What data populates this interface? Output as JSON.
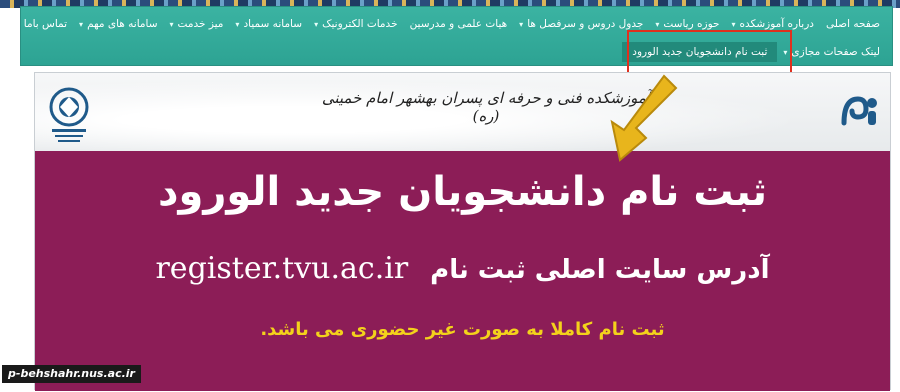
{
  "nav": {
    "row1": [
      {
        "label": "صفحه اصلی",
        "dropdown": false
      },
      {
        "label": "درباره آموزشکده",
        "dropdown": true
      },
      {
        "label": "حوزه ریاست",
        "dropdown": true
      },
      {
        "label": "جدول دروس و سرفصل ها",
        "dropdown": true
      },
      {
        "label": "هیات علمی و مدرسین",
        "dropdown": false
      },
      {
        "label": "خدمات الکترونیک",
        "dropdown": true
      },
      {
        "label": "سامانه سمیاد",
        "dropdown": true
      },
      {
        "label": "میز خدمت",
        "dropdown": true
      },
      {
        "label": "سامانه های مهم",
        "dropdown": true
      },
      {
        "label": "تماس باما",
        "dropdown": false
      }
    ],
    "row2": [
      {
        "label": "ثبت نام دانشجویان جدید الورود",
        "dropdown": false,
        "active": true
      },
      {
        "label": "لینک صفحات مجازی",
        "dropdown": true
      }
    ],
    "chevron": "▾"
  },
  "banner": {
    "school_title": "آموزشکده فنی و حرفه ای پسران بهشهر امام خمینی (ره)",
    "headline": "ثبت نام دانشجویان جدید الورود",
    "address_label": "آدرس سایت اصلی ثبت نام",
    "address_url": "register.tvu.ac.ir",
    "note": "ثبت نام کاملا به صورت غیر حضوری می باشد."
  },
  "watermark": "p-behshahr.nus.ac.ir",
  "colors": {
    "nav_teal": "#2da393",
    "panel_maroon": "#8c1d57",
    "note_yellow": "#f3d21b",
    "arrow_gold": "#e8b51c",
    "highlight_red": "#e0301e"
  },
  "icons": {
    "left_logo": "school-emblem-icon",
    "right_logo": "tvu-logo-icon",
    "arrow": "pointer-arrow-icon"
  }
}
